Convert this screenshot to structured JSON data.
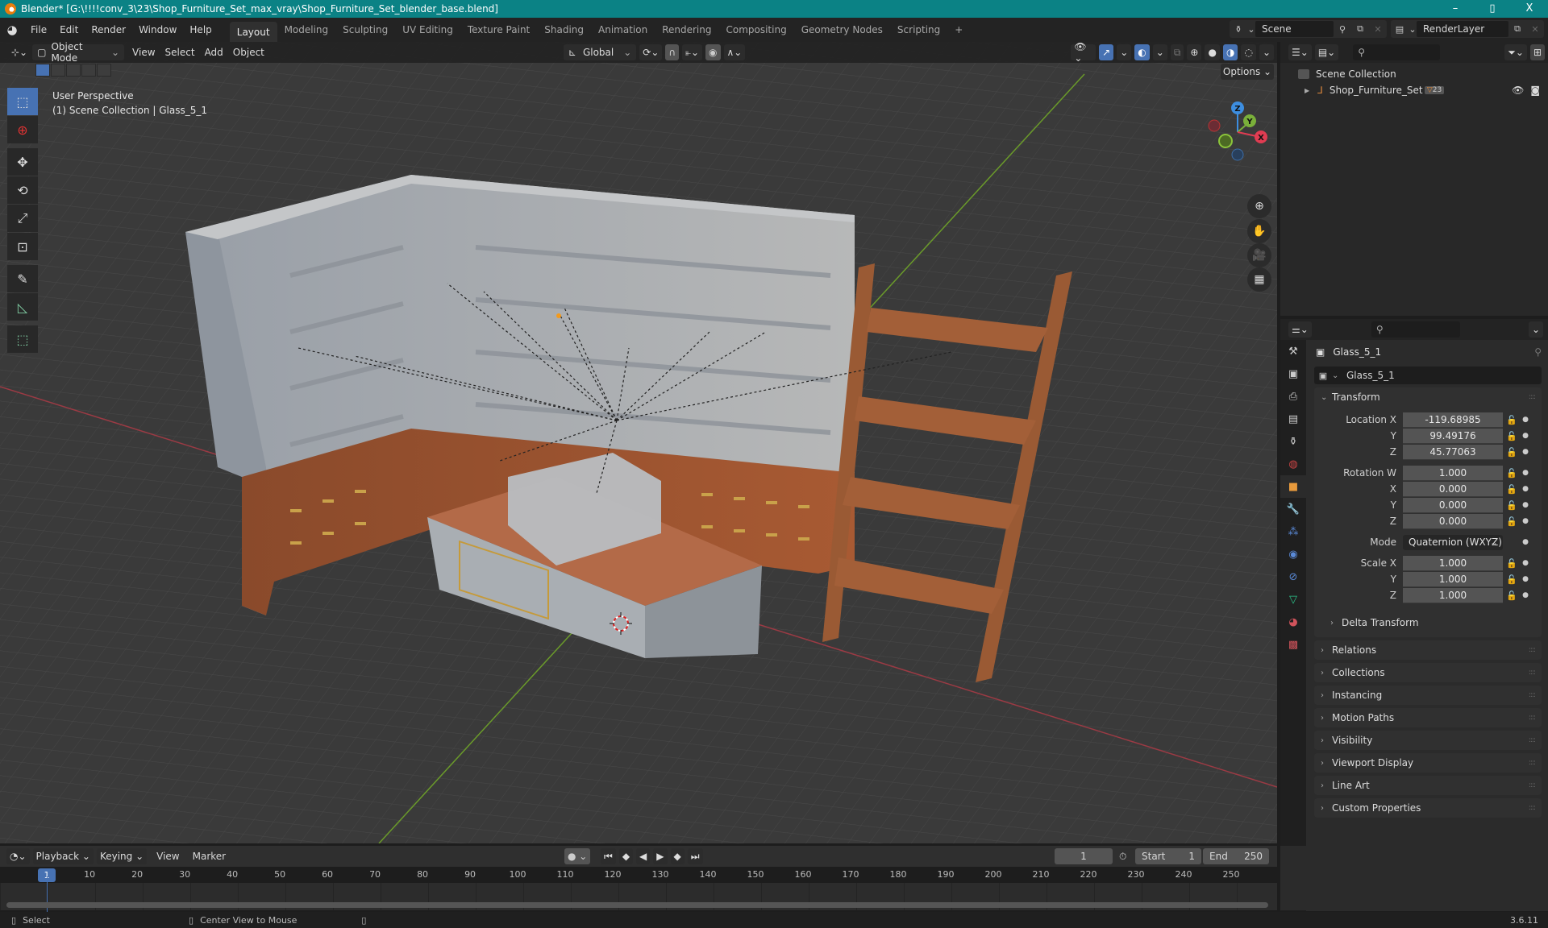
{
  "window": {
    "title": "Blender* [G:\\!!!!conv_3\\23\\Shop_Furniture_Set_max_vray\\Shop_Furniture_Set_blender_base.blend]",
    "minimize": "–",
    "maximize": "▯",
    "close": "X"
  },
  "menu": [
    "File",
    "Edit",
    "Render",
    "Window",
    "Help"
  ],
  "workspaces": [
    "Layout",
    "Modeling",
    "Sculpting",
    "UV Editing",
    "Texture Paint",
    "Shading",
    "Animation",
    "Rendering",
    "Compositing",
    "Geometry Nodes",
    "Scripting"
  ],
  "workspace_add": "+",
  "active_workspace": "Layout",
  "scene": {
    "label": "Scene"
  },
  "render_layer": {
    "label": "RenderLayer"
  },
  "viewport": {
    "mode": "Object Mode",
    "menus": [
      "View",
      "Select",
      "Add",
      "Object"
    ],
    "orientation": "Global",
    "options": "Options",
    "info_line1": "User Perspective",
    "info_line2": "(1) Scene Collection | Glass_5_1",
    "gizmo": {
      "x": "X",
      "y": "Y",
      "z": "Z"
    }
  },
  "outliner": {
    "search_placeholder": "",
    "root": "Scene Collection",
    "items": [
      {
        "name": "Shop_Furniture_Set",
        "badge": "23"
      }
    ]
  },
  "properties": {
    "object_name": "Glass_5_1",
    "datablock_name": "Glass_5_1",
    "transform_label": "Transform",
    "location": {
      "label": "Location X",
      "x": "-119.68985",
      "y": "99.49176",
      "z": "45.77063"
    },
    "rotation": {
      "label": "Rotation W",
      "w": "1.000",
      "x": "0.000",
      "y": "0.000",
      "z": "0.000"
    },
    "mode_label": "Mode",
    "mode_value": "Quaternion (WXYZ)",
    "scale": {
      "label": "Scale X",
      "x": "1.000",
      "y": "1.000",
      "z": "1.000"
    },
    "axis_labels": {
      "x": "X",
      "y": "Y",
      "z": "Z"
    },
    "delta_transform": "Delta Transform",
    "panels": [
      "Relations",
      "Collections",
      "Instancing",
      "Motion Paths",
      "Visibility",
      "Viewport Display",
      "Line Art",
      "Custom Properties"
    ]
  },
  "timeline": {
    "menus": [
      "Playback",
      "Keying",
      "View",
      "Marker"
    ],
    "current_frame": "1",
    "start_label": "Start",
    "start": "1",
    "end_label": "End",
    "end": "250",
    "ticks": [
      "10",
      "20",
      "30",
      "40",
      "50",
      "60",
      "70",
      "80",
      "90",
      "100",
      "110",
      "120",
      "130",
      "140",
      "150",
      "160",
      "170",
      "180",
      "190",
      "200",
      "210",
      "220",
      "230",
      "240",
      "250"
    ]
  },
  "statusbar": {
    "select": "Select",
    "center_view": "Center View to Mouse",
    "version": "3.6.11"
  }
}
